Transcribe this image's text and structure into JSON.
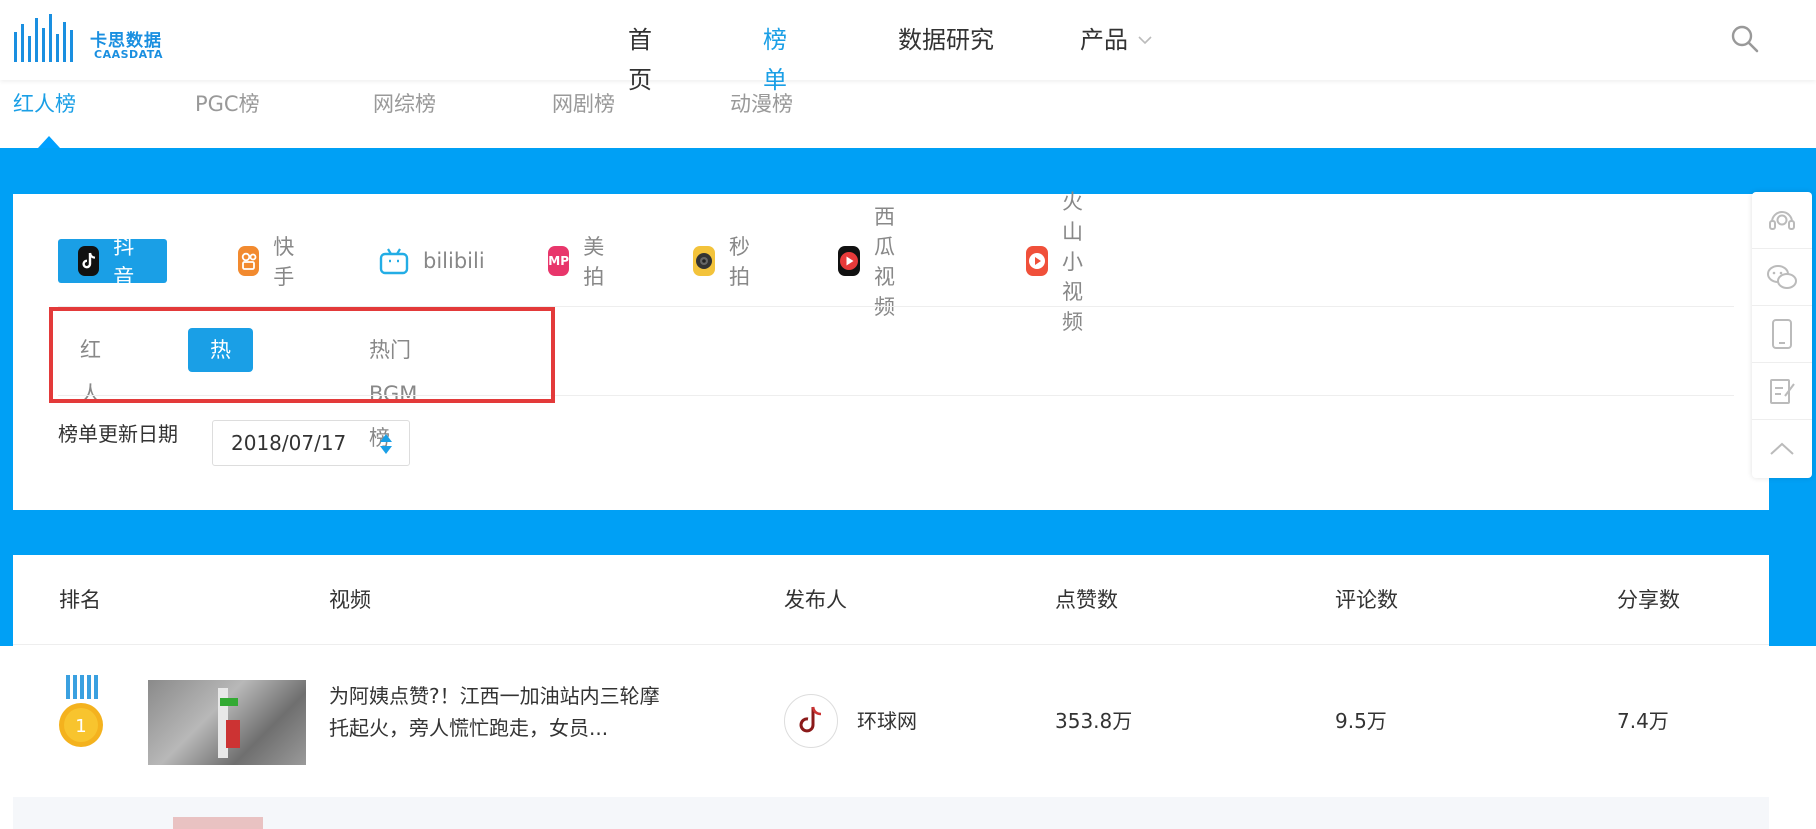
{
  "header": {
    "logo_cn": "卡思数据",
    "logo_en": "CAASDATA",
    "nav": [
      {
        "label": "首页"
      },
      {
        "label": "榜单"
      },
      {
        "label": "数据研究"
      },
      {
        "label": "产品"
      }
    ]
  },
  "subtabs": [
    "红人榜",
    "PGC榜",
    "网综榜",
    "网剧榜",
    "动漫榜"
  ],
  "platforms": [
    {
      "label": "抖音",
      "icon": "douyin-icon"
    },
    {
      "label": "快手",
      "icon": "kuaishou-icon"
    },
    {
      "label": "bilibili",
      "icon": "bilibili-icon"
    },
    {
      "label": "美拍",
      "icon": "meipai-icon"
    },
    {
      "label": "秒拍",
      "icon": "miaopai-icon"
    },
    {
      "label": "西瓜视频",
      "icon": "xigua-icon"
    },
    {
      "label": "火山小视频",
      "icon": "huoshan-icon"
    }
  ],
  "subcats": [
    "红人",
    "热门视频",
    "热门BGM榜"
  ],
  "date": {
    "label": "榜单更新日期",
    "value": "2018/07/17"
  },
  "table": {
    "headers": [
      "排名",
      "视频",
      "发布人",
      "点赞数",
      "评论数",
      "分享数"
    ],
    "rows": [
      {
        "rank": "1",
        "title": "为阿姨点赞?！江西一加油站内三轮摩托起火，旁人慌忙跑走，女员...",
        "publisher": "环球网",
        "likes": "353.8万",
        "comments": "9.5万",
        "shares": "7.4万"
      }
    ]
  },
  "colors": {
    "accent": "#1a9fe6",
    "band": "#00a0f5",
    "highlight_box": "#e33a3a"
  }
}
